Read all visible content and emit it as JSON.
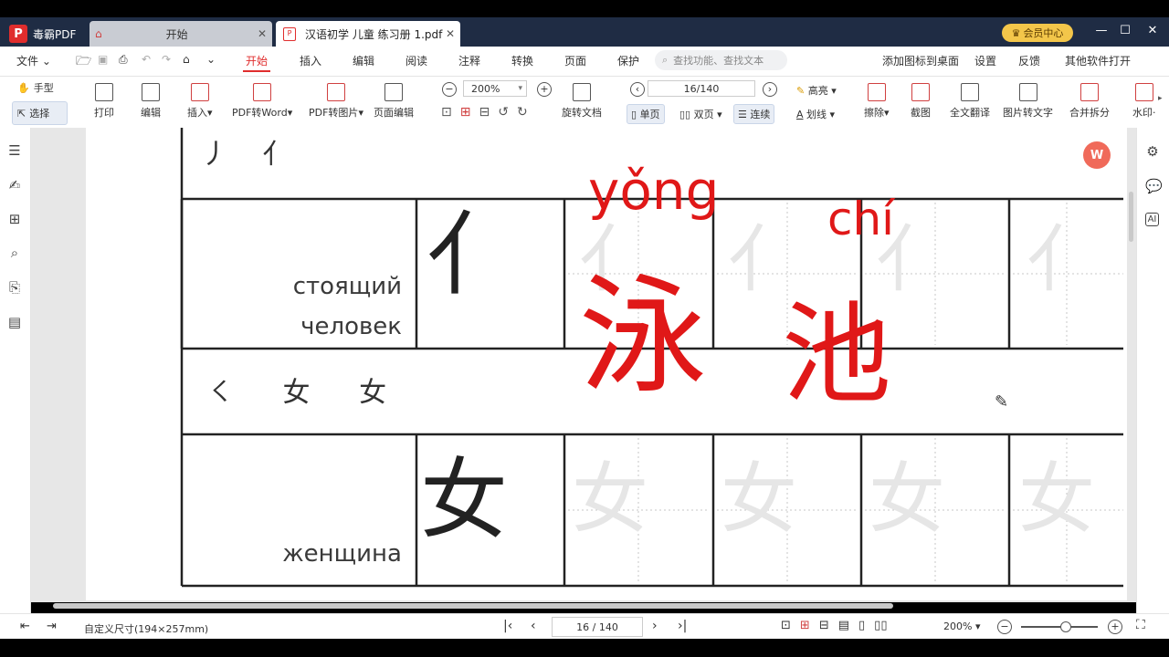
{
  "titlebar": {
    "app_name": "毒霸PDF",
    "start_tab": "开始",
    "doc_tab": "汉语初学 儿童 练习册 1.pdf",
    "vip": "会员中心"
  },
  "menu": {
    "file": "文件",
    "items": [
      "开始",
      "插入",
      "编辑",
      "阅读",
      "注释",
      "转换",
      "页面",
      "保护"
    ],
    "search_placeholder": "查找功能、查找文本",
    "right_items": [
      "添加图标到桌面",
      "设置",
      "反馈",
      "其他软件打开"
    ]
  },
  "toolbar": {
    "hand": "手型",
    "select": "选择",
    "print": "打印",
    "edit": "编辑",
    "insert": "插入",
    "pdf_to_word": "PDF转Word",
    "pdf_to_image": "PDF转图片",
    "page_edit": "页面编辑",
    "zoom": "200%",
    "rotate": "旋转文档",
    "page": "16/140",
    "single": "单页",
    "double": "双页",
    "continuous": "连续",
    "highlight": "高亮",
    "underline": "划线",
    "erase": "擦除",
    "screenshot": "截图",
    "translate": "全文翻译",
    "ocr": "图片转文字",
    "merge": "合并拆分",
    "watermark": "水印"
  },
  "document": {
    "strokes_top": "丿 亻",
    "row1_label": [
      "стоящий",
      "человек"
    ],
    "row1_char": "亻",
    "strokes_mid": "㇛ 女 女",
    "row2_label": "женщина",
    "row2_char": "女",
    "annotation": {
      "pinyin1": "yǒng",
      "pinyin2": "chí",
      "char1": "泳",
      "char2": "池",
      "color": "#e01818"
    }
  },
  "status": {
    "page_size": "自定义尺寸(194×257mm)",
    "page_nav": "16 / 140",
    "zoom": "200%"
  }
}
